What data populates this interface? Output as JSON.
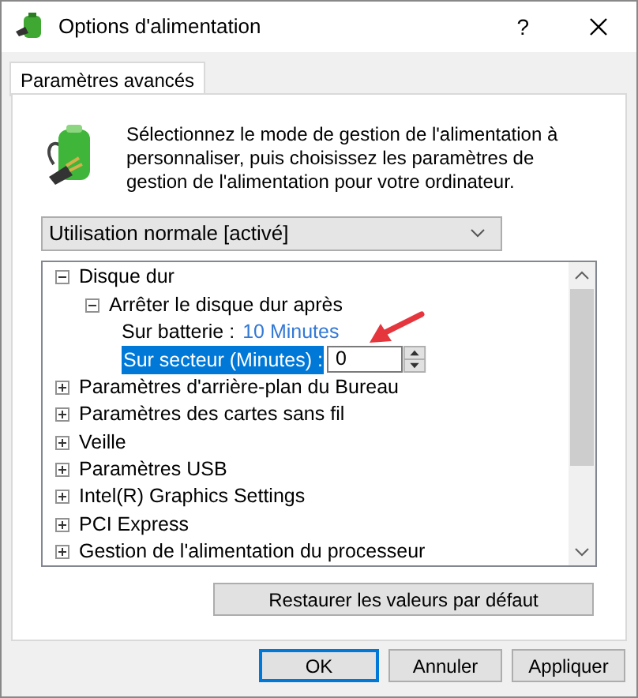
{
  "window": {
    "title": "Options d'alimentation",
    "help": "?"
  },
  "tabs": [
    {
      "label": "Paramètres avancés",
      "selected": true
    }
  ],
  "description": "Sélectionnez le mode de gestion de l'alimentation à personnaliser, puis choisissez les paramètres de gestion de l'alimentation pour votre ordinateur.",
  "plan_select": {
    "value": "Utilisation normale [activé]"
  },
  "tree": [
    {
      "kind": "group",
      "label": "Disque dur",
      "expanded": true,
      "children": [
        {
          "kind": "group",
          "label": "Arrêter le disque dur après",
          "expanded": true,
          "children": [
            {
              "kind": "value",
              "label": "Sur batterie :",
              "value": "10 Minutes"
            },
            {
              "kind": "spin",
              "label": "Sur secteur (Minutes) :",
              "value": "0",
              "selected": true
            }
          ]
        }
      ]
    },
    {
      "kind": "group",
      "label": "Paramètres d'arrière-plan du Bureau",
      "expanded": false
    },
    {
      "kind": "group",
      "label": "Paramètres des cartes sans fil",
      "expanded": false
    },
    {
      "kind": "group",
      "label": "Veille",
      "expanded": false
    },
    {
      "kind": "group",
      "label": "Paramètres USB",
      "expanded": false
    },
    {
      "kind": "group",
      "label": "Intel(R) Graphics Settings",
      "expanded": false
    },
    {
      "kind": "group",
      "label": "PCI Express",
      "expanded": false
    },
    {
      "kind": "group",
      "label": "Gestion de l'alimentation du processeur",
      "expanded": false
    }
  ],
  "restore_button": "Restaurer les valeurs par défaut",
  "buttons": [
    {
      "label": "OK",
      "default": true
    },
    {
      "label": "Annuler",
      "default": false
    },
    {
      "label": "Appliquer",
      "default": false
    }
  ]
}
